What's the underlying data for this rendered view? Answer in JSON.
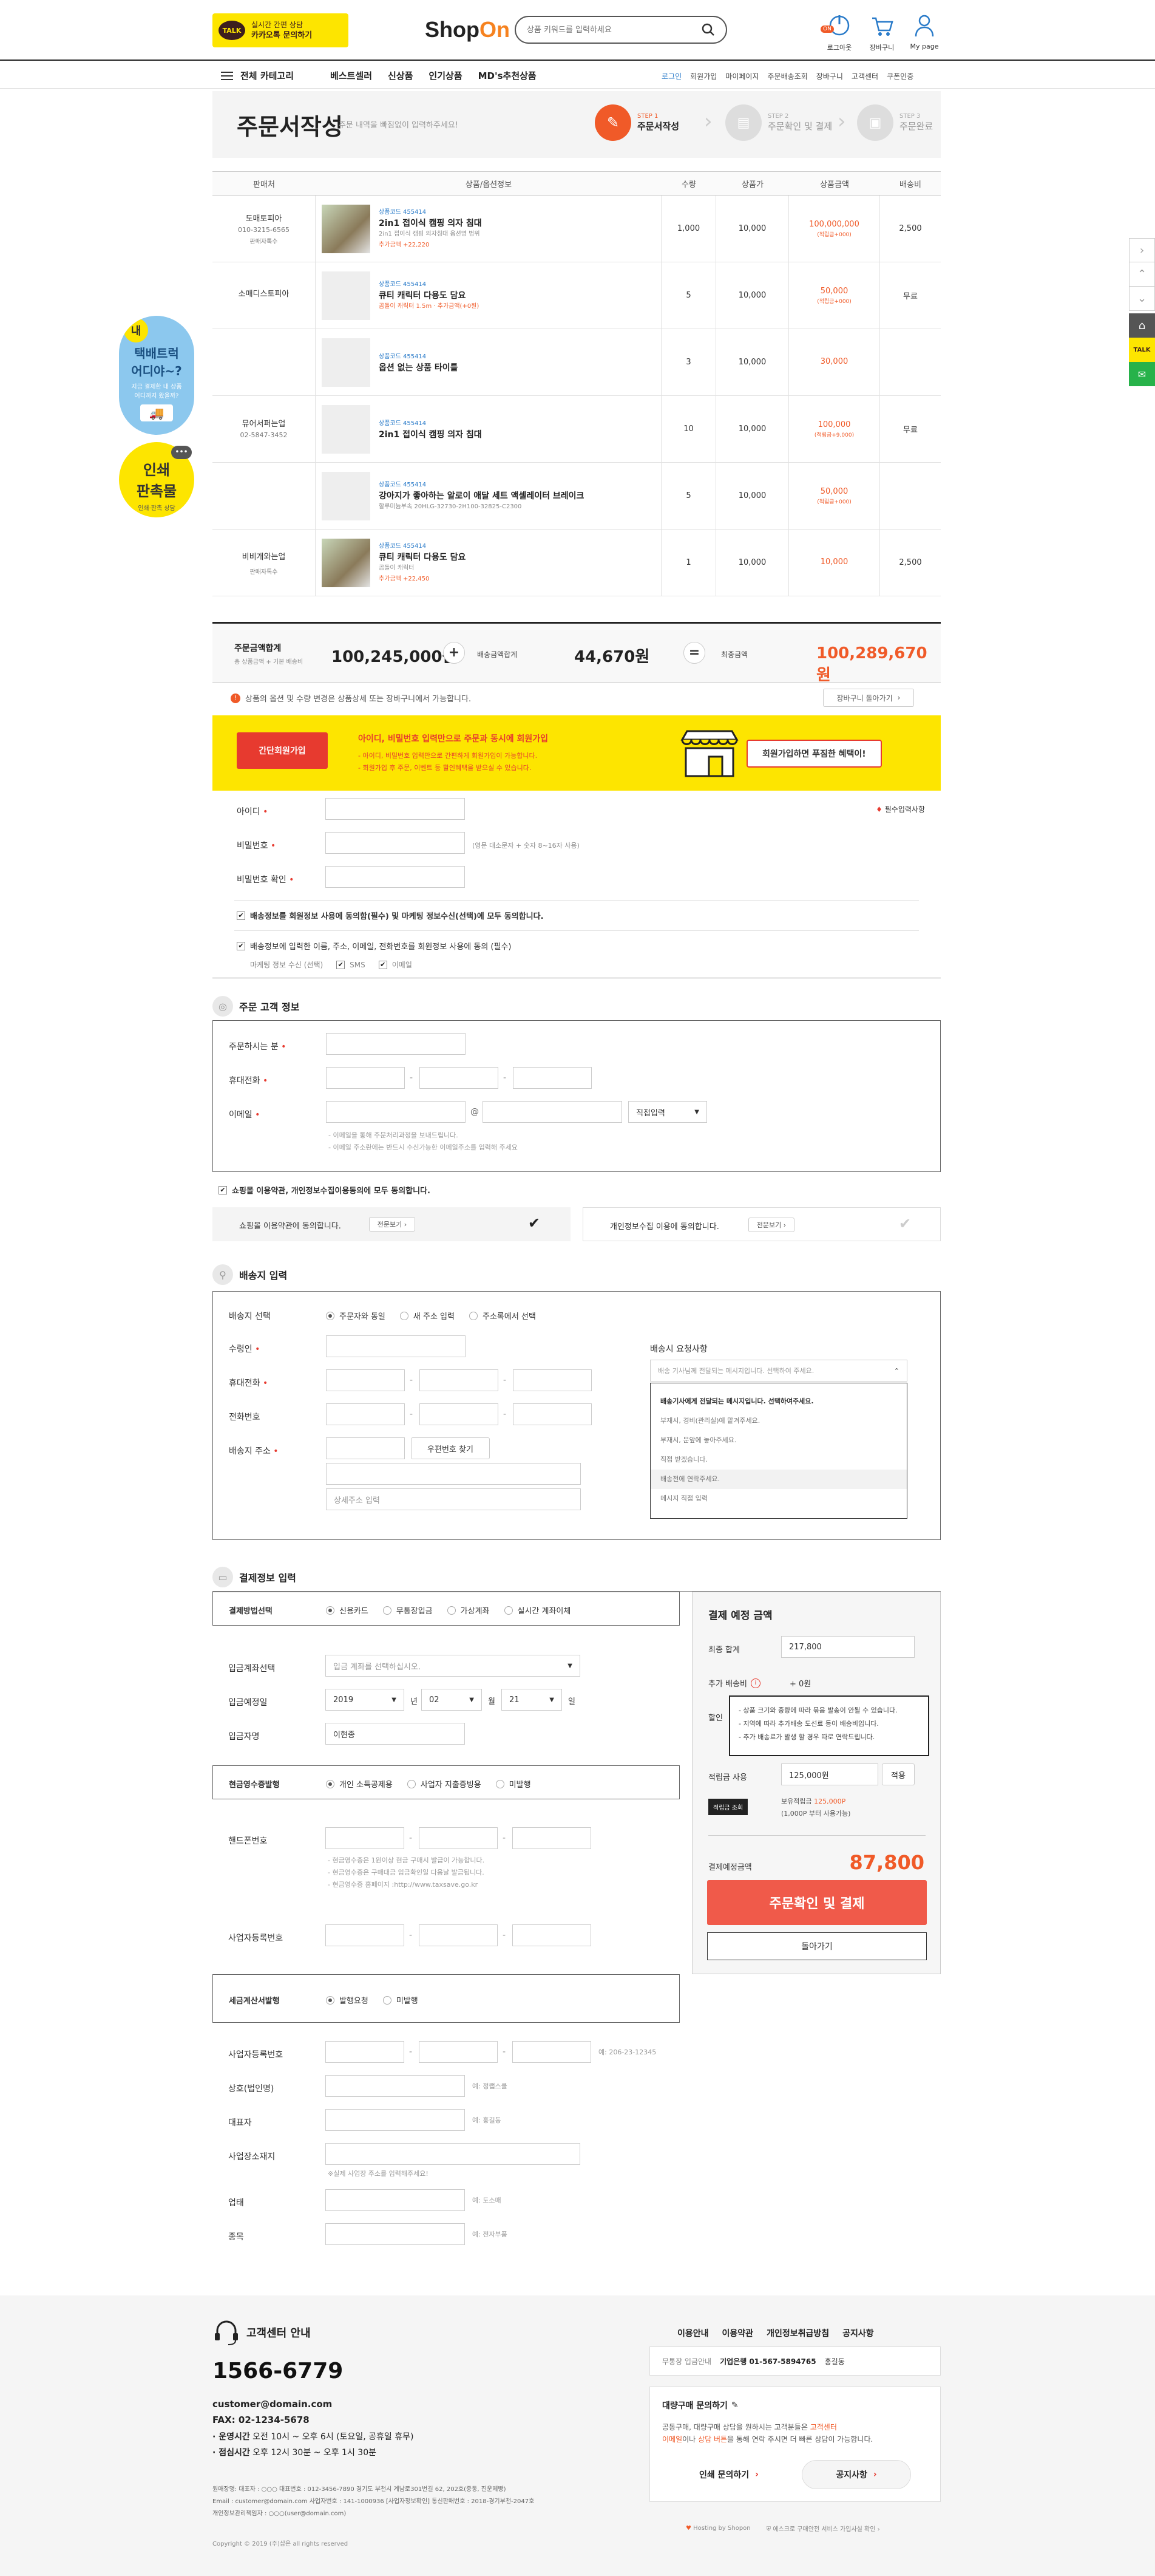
{
  "header": {
    "kakao_badge": "TALK",
    "kakao_line1": "실시간 간편 상담",
    "kakao_line2": "카카오톡 문의하기",
    "logo_a": "Shop",
    "logo_b": "On",
    "search_placeholder": "상품 키워드를 입력하세요",
    "icons": [
      {
        "label": "로그아웃",
        "badge": "ON"
      },
      {
        "label": "장바구니",
        "badge": ""
      },
      {
        "label": "My page",
        "badge": ""
      }
    ]
  },
  "nav": {
    "all_category": "전체 카테고리",
    "items": [
      "베스트셀러",
      "신상품",
      "인기상품",
      "MD's추천상품"
    ],
    "util": [
      "로그인",
      "회원가입",
      "마이페이지",
      "주문배송조회",
      "장바구니",
      "고객센터",
      "쿠폰인증"
    ]
  },
  "page": {
    "title": "주문서작성",
    "subtitle": "주문 내역을 빠짐없이 입력하주세요!",
    "steps": [
      {
        "step": "STEP 1",
        "label": "주문서작성",
        "active": true
      },
      {
        "step": "STEP 2",
        "label": "주문확인 및 결제",
        "active": false
      },
      {
        "step": "STEP 3",
        "label": "주문완료",
        "active": false
      }
    ]
  },
  "table": {
    "headers": [
      "판매처",
      "상품/옵션정보",
      "수량",
      "상품가",
      "상품금액",
      "배송비"
    ],
    "rows": [
      {
        "seller": "도매토피아",
        "phone": "010-3215-6565",
        "sub": "판매자톡수",
        "code": "상품코드 455414",
        "name": "2in1 접이식 캠핑 의자 침대",
        "opt": "2in1 접이식 캠핑 의자침대 옵션명 범위",
        "extra": "추가금액 +22,220",
        "qty": "1,000",
        "price": "10,000",
        "amount": "100,000,000",
        "amount_note": "(적립금+000)",
        "ship": "2,500",
        "photo": true
      },
      {
        "seller": "소매디스토피아",
        "phone": "",
        "sub": "",
        "code": "상품코드 455414",
        "name": "큐티 캐릭터 다용도 담요",
        "opt": "",
        "extra": "곰돌이 캐릭터 1.5m · 추가금액(+0원)",
        "qty": "5",
        "price": "10,000",
        "amount": "50,000",
        "amount_note": "(적립금+000)",
        "ship": "무료",
        "photo": false
      },
      {
        "seller": "",
        "phone": "",
        "sub": "",
        "code": "상품코드 455414",
        "name": "옵션 없는 상품 타이틀",
        "opt": "",
        "extra": "",
        "qty": "3",
        "price": "10,000",
        "amount": "30,000",
        "amount_note": "",
        "ship": "",
        "photo": false
      },
      {
        "seller": "뮤어서퍼는업",
        "phone": "02-5847-3452",
        "sub": "",
        "code": "상품코드 455414",
        "name": "2in1 접이식 캠핑 의자 침대",
        "opt": "",
        "extra": "",
        "qty": "10",
        "price": "10,000",
        "amount": "100,000",
        "amount_note": "(적립금+9,000)",
        "ship": "무료",
        "photo": false
      },
      {
        "seller": "",
        "phone": "",
        "sub": "",
        "code": "상품코드 455414",
        "name": "강아지가 좋아하는 알로이 애달 세트 액셀레이터 브레이크",
        "opt": "할루미늄부속 20HLG-32730-2H100-32825-C2300",
        "extra": "",
        "qty": "5",
        "price": "10,000",
        "amount": "50,000",
        "amount_note": "(적립금+000)",
        "ship": "",
        "photo": false
      },
      {
        "seller": "비비개와는업",
        "phone": "",
        "sub": "판매자톡수",
        "code": "상품코드 455414",
        "name": "큐티 캐릭터 다용도 담요",
        "opt": "곰돌이 캐릭터",
        "extra": "추가금액 +22,450",
        "qty": "1",
        "price": "10,000",
        "amount": "10,000",
        "amount_note": "",
        "ship": "2,500",
        "photo": true
      }
    ]
  },
  "totals": {
    "goods_label": "주문금액합계",
    "goods_sub": "총 상품금액 + 기본 배송비",
    "goods_value": "100,245,000원",
    "ship_label": "배송금액합계",
    "ship_value": "44,670원",
    "final_label": "최종금액",
    "final_value": "100,289,670원",
    "notice": "상품의 옵션 및 수량 변경은 상품상세 또는 장바구니에서 가능합니다.",
    "cart_button": "장바구니 돌아가기"
  },
  "join_banner": {
    "button": "간단회원가입",
    "title": "아이디, 비밀번호 입력만으로 주문과 동시에 회원가입",
    "line1": "- 아이디, 비밀번호 입력만으로 간편하게 회원가입이 가능합니다.",
    "line2": "- 회원가입 후 주문, 이벤트 등 할인혜택을 받으실 수 있습니다.",
    "bubble": "회원가입하면 푸짐한 혜택이!"
  },
  "join_form": {
    "required_note": "필수입력사항",
    "id_label": "아이디",
    "pw_label": "비밀번호",
    "pw_hint": "(영문 대소문자 + 숫자 8~16자 사용)",
    "pw2_label": "비밀번호 확인",
    "agree1": "배송정보를 회원정보 사용에 동의함(필수) 및 마케팅 정보수신(선택)에 모두 동의합니다.",
    "agree2": "배송정보에 입력한 이름, 주소, 이메일, 전화번호를 회원정보 사용에 동의 (필수)",
    "marketing": "마케팅 정보 수신 (선택)",
    "sms": "SMS",
    "email": "이메일"
  },
  "orderer": {
    "title": "주문 고객 정보",
    "name_label": "주문하시는 분",
    "mobile_label": "휴대전화",
    "email_label": "이메일",
    "email_at": "@",
    "email_select": "직접입력",
    "note1": "- 이메일을 통해 주문처리과정을 보내드립니다.",
    "note2": "- 이메일 주소란에는 반드시 수신가능한 이메일주소를 입력해 주세요",
    "agree_all": "쇼핑몰 이용약관, 개인정보수집이용동의에 모두 동의합니다.",
    "terms1": "쇼핑몰 이용약관에 동의합니다.",
    "terms2": "개인정보수집 이용에 동의합니다.",
    "view": "전문보기"
  },
  "shipping": {
    "title": "배송지 입력",
    "select_label": "배송지 선택",
    "options": [
      "주문자와 동일",
      "새 주소 입력",
      "주소록에서 선택"
    ],
    "receiver_label": "수령인",
    "mobile_label": "휴대전화",
    "phone_label": "전화번호",
    "address_label": "배송지 주소",
    "zip_button": "우편번호 찾기",
    "detail_placeholder": "상세주소 입력",
    "request_label": "배송시 요청사항",
    "request_placeholder": "배송 기사님께 전달되는 메시지입니다. 선택하여 주세요.",
    "request_options": [
      "배송기사에게 전달되는 메시지입니다. 선택하여주세요.",
      "부재시, 경비(관리실)에 맡겨주세요.",
      "부재시, 문앞에 놓아주세요.",
      "직접 받겠습니다.",
      "배송전에 연락주세요.",
      "메시지 직접 입력"
    ]
  },
  "payment": {
    "title": "결제정보 입력",
    "method_label": "결제방법선택",
    "methods": [
      "신용카드",
      "무통장입금",
      "가상계좌",
      "실시간 계좌이체"
    ],
    "bank_label": "입금계좌선택",
    "bank_placeholder": "입금 계좌를 선택하십시오.",
    "date_label": "입금예정일",
    "year": "2019",
    "year_unit": "년",
    "month": "02",
    "month_unit": "월",
    "day": "21",
    "day_unit": "일",
    "payer_label": "입금자명",
    "payer": "이현종",
    "receipt_label": "현금영수증발행",
    "receipt_opts": [
      "개인 소득공제용",
      "사업자 지출증빙용",
      "미발행"
    ],
    "phone_label": "핸드폰번호",
    "receipt_note1": "- 현금영수증은 1원이상 현금 구매시 발급이 가능합니다.",
    "receipt_note2": "- 현금영수증은 구매대금 입금확인일 다음날 발급됩니다.",
    "receipt_note3": "- 현금영수증 홈페이지 :http://www.taxsave.go.kr",
    "bizno_label": "사업자등록번호",
    "tax_label": "세금계산서발행",
    "tax_opts": [
      "발행요청",
      "미발행"
    ],
    "tax_bizno_label": "사업자등록번호",
    "tax_bizno_ex": "예: 206-23-12345",
    "company_label": "상호(법인명)",
    "company_ex": "예: 정랩스쿨",
    "ceo_label": "대표자",
    "ceo_ex": "예: 홍길동",
    "addr_label": "사업장소재지",
    "addr_note": "※실제 사업장 주소를 입력해주세요!",
    "biz_label": "업태",
    "biz_ex": "예: 도소매",
    "item_label": "종목",
    "item_ex": "예: 전자부품"
  },
  "summary": {
    "title": "결제 예정 금액",
    "total_label": "최종 합계",
    "total_value": "217,800",
    "extra_label": "추가 배송비",
    "extra_value": "+ 0원",
    "tooltip1": "- 상품 크기와 중량에 따라 묶음 발송이 안될 수 있습니다.",
    "tooltip2": "- 지역에 따라 추가배송 도선료 등이 배송비입니다.",
    "tooltip3": "- 추가 배송료가 발생 할 경우 따로 연락드립니다.",
    "discount_label": "할인",
    "point_label": "적립금 사용",
    "point_value": "125,000원",
    "point_button": "적용",
    "point_badge": "적립금 조회",
    "point_have_label": "보유적립금",
    "point_have": "125,000P",
    "point_min": "(1,000P 부터 사용가능)",
    "pay_label": "결제예정금액",
    "pay_value": "87,800",
    "pay_button": "주문확인 및 결제",
    "back_button": "돌아가기"
  },
  "footer": {
    "cs_title": "고객센터 안내",
    "phone": "1566-6779",
    "email": "customer@domain.com",
    "fax": "FAX: 02-1234-5678",
    "hours1_label": "· 운영시간",
    "hours1": "오전 10시 ~ 오후 6시 (토요일, 공휴일 휴무)",
    "hours2_label": "· 점심시간",
    "hours2": "오후 12시 30분 ~ 오후 1시 30분",
    "company1": "원매장명: 대표자 : ○○○  대표번호 : 012-3456-7890  경기도 부천시 계남로301번길 62, 202호(중동, 진운제빵)",
    "company2": "Email : customer@domain.com  사업자번호 : 141-1000936 [사업자정보확인]  통신판매번호 : 2018-경기부천-2047호",
    "company3": "개인정보관리책임자 : ○○○(user@domain.com)",
    "copyright": "Copyright © 2019 (주)샵온 all rights reserved",
    "links": [
      "이용안내",
      "이용약관",
      "개인정보취급방침",
      "공지사항"
    ],
    "bank_label": "무통장 입금안내",
    "bank_value": "기업은행 01-567-5894765",
    "bank_owner": "홍길동",
    "bulk_title": "대량구매 문의하기",
    "bulk_text1": "공동구매, 대량구매 상담을 원하시는 고객분들은",
    "bulk_text1b": "고객센터",
    "bulk_text2": "이메일",
    "bulk_text2b": "이나",
    "bulk_text2c": "상담 버튼",
    "bulk_text2d": "을 통해 연락 주시면 더 빠른 상담이 가능합니다.",
    "bulk_button1": "인쇄 문의하기",
    "bulk_button2": "공지사항",
    "hosting": "Hosting by Shopon",
    "escrow": "에스크로 구매안전 서비스 가입사실 확인"
  },
  "side": {
    "courier_q1": "내",
    "courier_title1": "택배트럭",
    "courier_title2": "어디야~?",
    "courier_text": "지금 결제한 내 상품",
    "courier_text2": "어디까지 왔을까?",
    "print_title1": "인쇄",
    "print_title2": "판촉물",
    "print_text": "인쇄·판촉 상담"
  },
  "colors": {
    "accent": "#f05a28",
    "kakao": "#fde500",
    "brand_orange": "#f6821f",
    "pay_button": "#f05a4a"
  }
}
